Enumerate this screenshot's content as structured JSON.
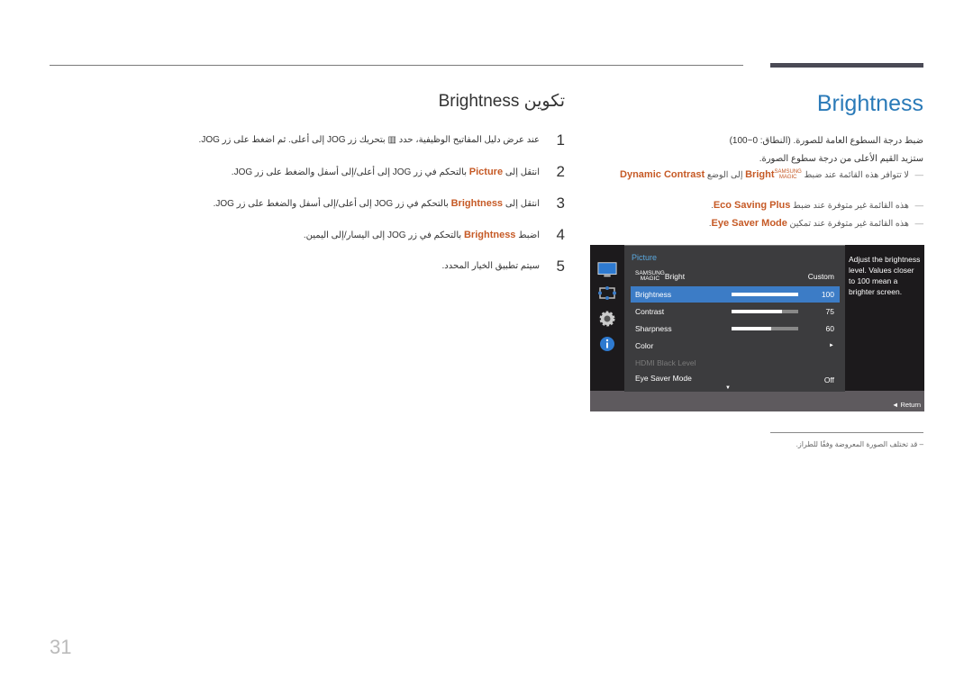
{
  "header": {
    "title_en": "Brightness",
    "title_ar_prefix": "تكوين",
    "title_ar_keyword": "Brightness"
  },
  "steps": [
    {
      "num": "1",
      "text": "عند عرض دليل المفاتيح الوظيفية، حدد ▥ بتحريك زر JOG إلى أعلى. ثم اضغط على زر JOG."
    },
    {
      "num": "2",
      "pre": "انتقل إلى",
      "keyword": "Picture",
      "post": "بالتحكم في زر JOG إلى أعلى/إلى أسفل والضغط على زر JOG."
    },
    {
      "num": "3",
      "pre": "انتقل إلى",
      "keyword": "Brightness",
      "post": "بالتحكم في زر JOG إلى أعلى/إلى أسفل والضغط على زر JOG."
    },
    {
      "num": "4",
      "pre": "اضبط",
      "keyword": "Brightness",
      "post": "بالتحكم في زر JOG إلى اليسار/إلى اليمين."
    },
    {
      "num": "5",
      "text": "سيتم تطبيق الخيار المحدد."
    }
  ],
  "description": {
    "line1": "ضبط درجة السطوع العامة للصورة. (النطاق: 0~100)",
    "line2": "ستزيد القيم الأعلى من درجة سطوع الصورة."
  },
  "notes": [
    {
      "pre": "لا تتوافر هذه القائمة عند ضبط",
      "magic_top": "SAMSUNG",
      "magic_bottom": "MAGIC",
      "keyword1": "Bright",
      "mid": "إلى الوضع",
      "keyword2": "Dynamic Contrast"
    },
    {
      "pre": "هذه القائمة غير متوفرة عند ضبط",
      "keyword": "Eco Saving Plus",
      "post": "."
    },
    {
      "pre": "هذه القائمة غير متوفرة عند تمكين",
      "keyword": "Eye Saver Mode",
      "post": "."
    }
  ],
  "osd": {
    "category": "Picture",
    "rows": [
      {
        "label": "Bright",
        "magic_top": "SAMSUNG",
        "magic_bottom": "MAGIC",
        "value": "Custom"
      },
      {
        "label": "Brightness",
        "value": "100",
        "level": 100,
        "selected": true
      },
      {
        "label": "Contrast",
        "value": "75",
        "level": 75
      },
      {
        "label": "Sharpness",
        "value": "60",
        "level": 60
      },
      {
        "label": "Color",
        "value": "►"
      },
      {
        "label": "HDMI Black Level",
        "value": "",
        "disabled": true
      },
      {
        "label": "Eye Saver Mode",
        "value": "Off"
      }
    ],
    "help_text": "Adjust the brightness level. Values closer to 100 mean a brighter screen.",
    "footer": "◄  Return",
    "more_arrow": "▼",
    "side_icons": [
      "monitor-icon",
      "resize-icon",
      "gear-icon",
      "info-icon"
    ]
  },
  "footnote": "–  قد تختلف الصورة المعروضة وفقًا للطراز.",
  "page_number": "31",
  "colors": {
    "accent_blue": "#2a7ab8",
    "keyword_orange": "#c65a26",
    "osd_select": "#3c7cc6"
  }
}
